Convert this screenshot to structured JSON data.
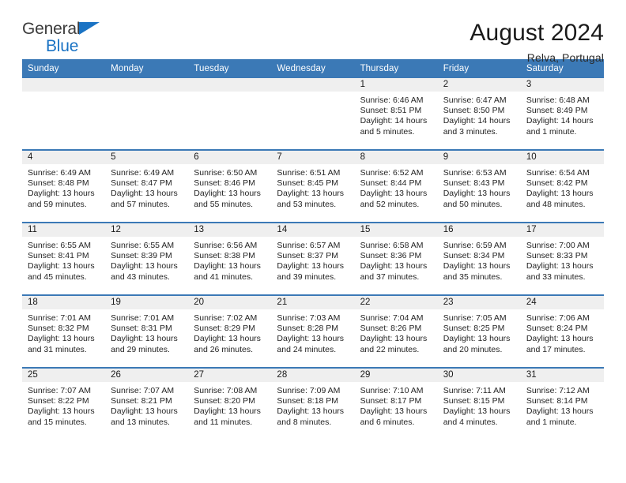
{
  "brand": {
    "name_top": "General",
    "name_bottom": "Blue",
    "triangle_icon": "triangle-icon",
    "color_blue": "#1a73c4",
    "color_dark": "#3c3c3c"
  },
  "header": {
    "title": "August 2024",
    "location": "Relva, Portugal"
  },
  "theme": {
    "header_blue": "#3b79b6",
    "daynum_band": "#efefef",
    "divider_blue": "#3b79b6"
  },
  "weekdays": [
    "Sunday",
    "Monday",
    "Tuesday",
    "Wednesday",
    "Thursday",
    "Friday",
    "Saturday"
  ],
  "labels": {
    "sunrise_prefix": "Sunrise:",
    "sunset_prefix": "Sunset:",
    "daylight_prefix": "Daylight:"
  },
  "weeks": [
    [
      {
        "day": "",
        "sunrise": "",
        "sunset": "",
        "daylight": ""
      },
      {
        "day": "",
        "sunrise": "",
        "sunset": "",
        "daylight": ""
      },
      {
        "day": "",
        "sunrise": "",
        "sunset": "",
        "daylight": ""
      },
      {
        "day": "",
        "sunrise": "",
        "sunset": "",
        "daylight": ""
      },
      {
        "day": "1",
        "sunrise": "Sunrise: 6:46 AM",
        "sunset": "Sunset: 8:51 PM",
        "daylight": "Daylight: 14 hours and 5 minutes."
      },
      {
        "day": "2",
        "sunrise": "Sunrise: 6:47 AM",
        "sunset": "Sunset: 8:50 PM",
        "daylight": "Daylight: 14 hours and 3 minutes."
      },
      {
        "day": "3",
        "sunrise": "Sunrise: 6:48 AM",
        "sunset": "Sunset: 8:49 PM",
        "daylight": "Daylight: 14 hours and 1 minute."
      }
    ],
    [
      {
        "day": "4",
        "sunrise": "Sunrise: 6:49 AM",
        "sunset": "Sunset: 8:48 PM",
        "daylight": "Daylight: 13 hours and 59 minutes."
      },
      {
        "day": "5",
        "sunrise": "Sunrise: 6:49 AM",
        "sunset": "Sunset: 8:47 PM",
        "daylight": "Daylight: 13 hours and 57 minutes."
      },
      {
        "day": "6",
        "sunrise": "Sunrise: 6:50 AM",
        "sunset": "Sunset: 8:46 PM",
        "daylight": "Daylight: 13 hours and 55 minutes."
      },
      {
        "day": "7",
        "sunrise": "Sunrise: 6:51 AM",
        "sunset": "Sunset: 8:45 PM",
        "daylight": "Daylight: 13 hours and 53 minutes."
      },
      {
        "day": "8",
        "sunrise": "Sunrise: 6:52 AM",
        "sunset": "Sunset: 8:44 PM",
        "daylight": "Daylight: 13 hours and 52 minutes."
      },
      {
        "day": "9",
        "sunrise": "Sunrise: 6:53 AM",
        "sunset": "Sunset: 8:43 PM",
        "daylight": "Daylight: 13 hours and 50 minutes."
      },
      {
        "day": "10",
        "sunrise": "Sunrise: 6:54 AM",
        "sunset": "Sunset: 8:42 PM",
        "daylight": "Daylight: 13 hours and 48 minutes."
      }
    ],
    [
      {
        "day": "11",
        "sunrise": "Sunrise: 6:55 AM",
        "sunset": "Sunset: 8:41 PM",
        "daylight": "Daylight: 13 hours and 45 minutes."
      },
      {
        "day": "12",
        "sunrise": "Sunrise: 6:55 AM",
        "sunset": "Sunset: 8:39 PM",
        "daylight": "Daylight: 13 hours and 43 minutes."
      },
      {
        "day": "13",
        "sunrise": "Sunrise: 6:56 AM",
        "sunset": "Sunset: 8:38 PM",
        "daylight": "Daylight: 13 hours and 41 minutes."
      },
      {
        "day": "14",
        "sunrise": "Sunrise: 6:57 AM",
        "sunset": "Sunset: 8:37 PM",
        "daylight": "Daylight: 13 hours and 39 minutes."
      },
      {
        "day": "15",
        "sunrise": "Sunrise: 6:58 AM",
        "sunset": "Sunset: 8:36 PM",
        "daylight": "Daylight: 13 hours and 37 minutes."
      },
      {
        "day": "16",
        "sunrise": "Sunrise: 6:59 AM",
        "sunset": "Sunset: 8:34 PM",
        "daylight": "Daylight: 13 hours and 35 minutes."
      },
      {
        "day": "17",
        "sunrise": "Sunrise: 7:00 AM",
        "sunset": "Sunset: 8:33 PM",
        "daylight": "Daylight: 13 hours and 33 minutes."
      }
    ],
    [
      {
        "day": "18",
        "sunrise": "Sunrise: 7:01 AM",
        "sunset": "Sunset: 8:32 PM",
        "daylight": "Daylight: 13 hours and 31 minutes."
      },
      {
        "day": "19",
        "sunrise": "Sunrise: 7:01 AM",
        "sunset": "Sunset: 8:31 PM",
        "daylight": "Daylight: 13 hours and 29 minutes."
      },
      {
        "day": "20",
        "sunrise": "Sunrise: 7:02 AM",
        "sunset": "Sunset: 8:29 PM",
        "daylight": "Daylight: 13 hours and 26 minutes."
      },
      {
        "day": "21",
        "sunrise": "Sunrise: 7:03 AM",
        "sunset": "Sunset: 8:28 PM",
        "daylight": "Daylight: 13 hours and 24 minutes."
      },
      {
        "day": "22",
        "sunrise": "Sunrise: 7:04 AM",
        "sunset": "Sunset: 8:26 PM",
        "daylight": "Daylight: 13 hours and 22 minutes."
      },
      {
        "day": "23",
        "sunrise": "Sunrise: 7:05 AM",
        "sunset": "Sunset: 8:25 PM",
        "daylight": "Daylight: 13 hours and 20 minutes."
      },
      {
        "day": "24",
        "sunrise": "Sunrise: 7:06 AM",
        "sunset": "Sunset: 8:24 PM",
        "daylight": "Daylight: 13 hours and 17 minutes."
      }
    ],
    [
      {
        "day": "25",
        "sunrise": "Sunrise: 7:07 AM",
        "sunset": "Sunset: 8:22 PM",
        "daylight": "Daylight: 13 hours and 15 minutes."
      },
      {
        "day": "26",
        "sunrise": "Sunrise: 7:07 AM",
        "sunset": "Sunset: 8:21 PM",
        "daylight": "Daylight: 13 hours and 13 minutes."
      },
      {
        "day": "27",
        "sunrise": "Sunrise: 7:08 AM",
        "sunset": "Sunset: 8:20 PM",
        "daylight": "Daylight: 13 hours and 11 minutes."
      },
      {
        "day": "28",
        "sunrise": "Sunrise: 7:09 AM",
        "sunset": "Sunset: 8:18 PM",
        "daylight": "Daylight: 13 hours and 8 minutes."
      },
      {
        "day": "29",
        "sunrise": "Sunrise: 7:10 AM",
        "sunset": "Sunset: 8:17 PM",
        "daylight": "Daylight: 13 hours and 6 minutes."
      },
      {
        "day": "30",
        "sunrise": "Sunrise: 7:11 AM",
        "sunset": "Sunset: 8:15 PM",
        "daylight": "Daylight: 13 hours and 4 minutes."
      },
      {
        "day": "31",
        "sunrise": "Sunrise: 7:12 AM",
        "sunset": "Sunset: 8:14 PM",
        "daylight": "Daylight: 13 hours and 1 minute."
      }
    ]
  ]
}
